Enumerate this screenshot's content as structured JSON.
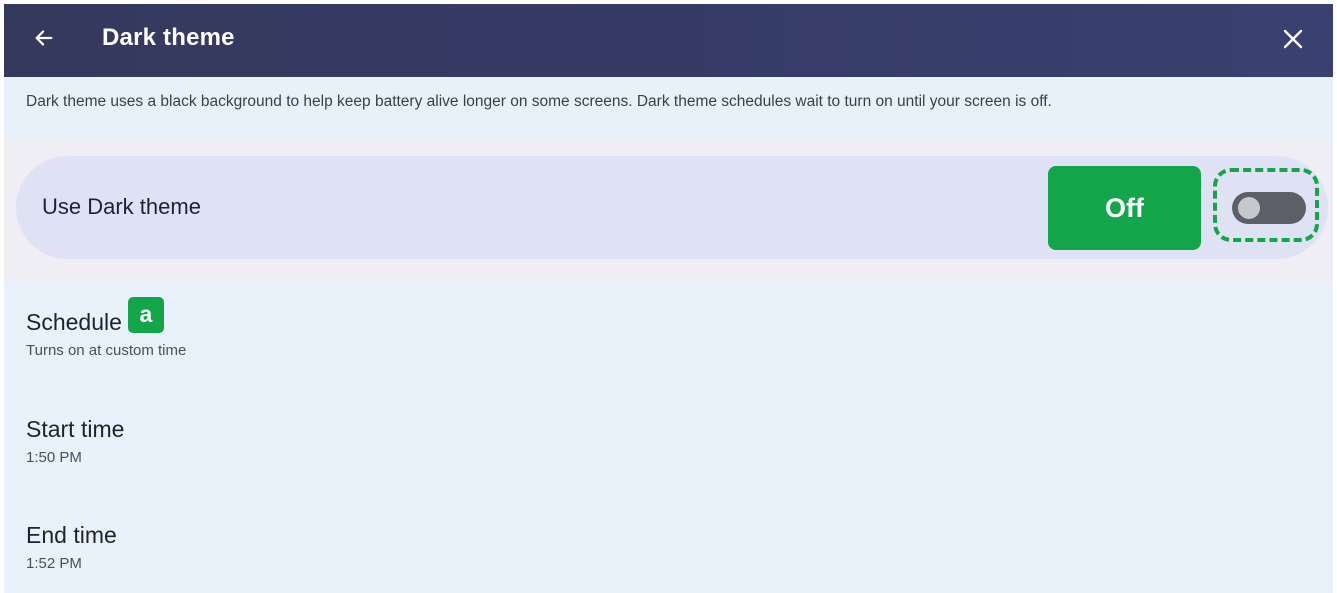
{
  "header": {
    "title": "Dark theme",
    "back_icon": "arrow-left-icon",
    "close_icon": "close-icon"
  },
  "description": "Dark theme uses a black background to help keep battery alive longer on some screens. Dark theme schedules wait to turn on until your screen is off.",
  "toggle": {
    "label": "Use Dark theme",
    "state_label": "Off",
    "checked": false
  },
  "schedule": {
    "title": "Schedule",
    "badge": "a",
    "subtitle": "Turns on at custom time"
  },
  "start_time": {
    "title": "Start time",
    "value": "1:50 PM"
  },
  "end_time": {
    "title": "End time",
    "value": "1:52 PM"
  },
  "colors": {
    "header_bg": "#363b66",
    "accent_green": "#12a54a",
    "page_bg": "#e9f2fb",
    "card_bg": "#dfe1f5"
  }
}
